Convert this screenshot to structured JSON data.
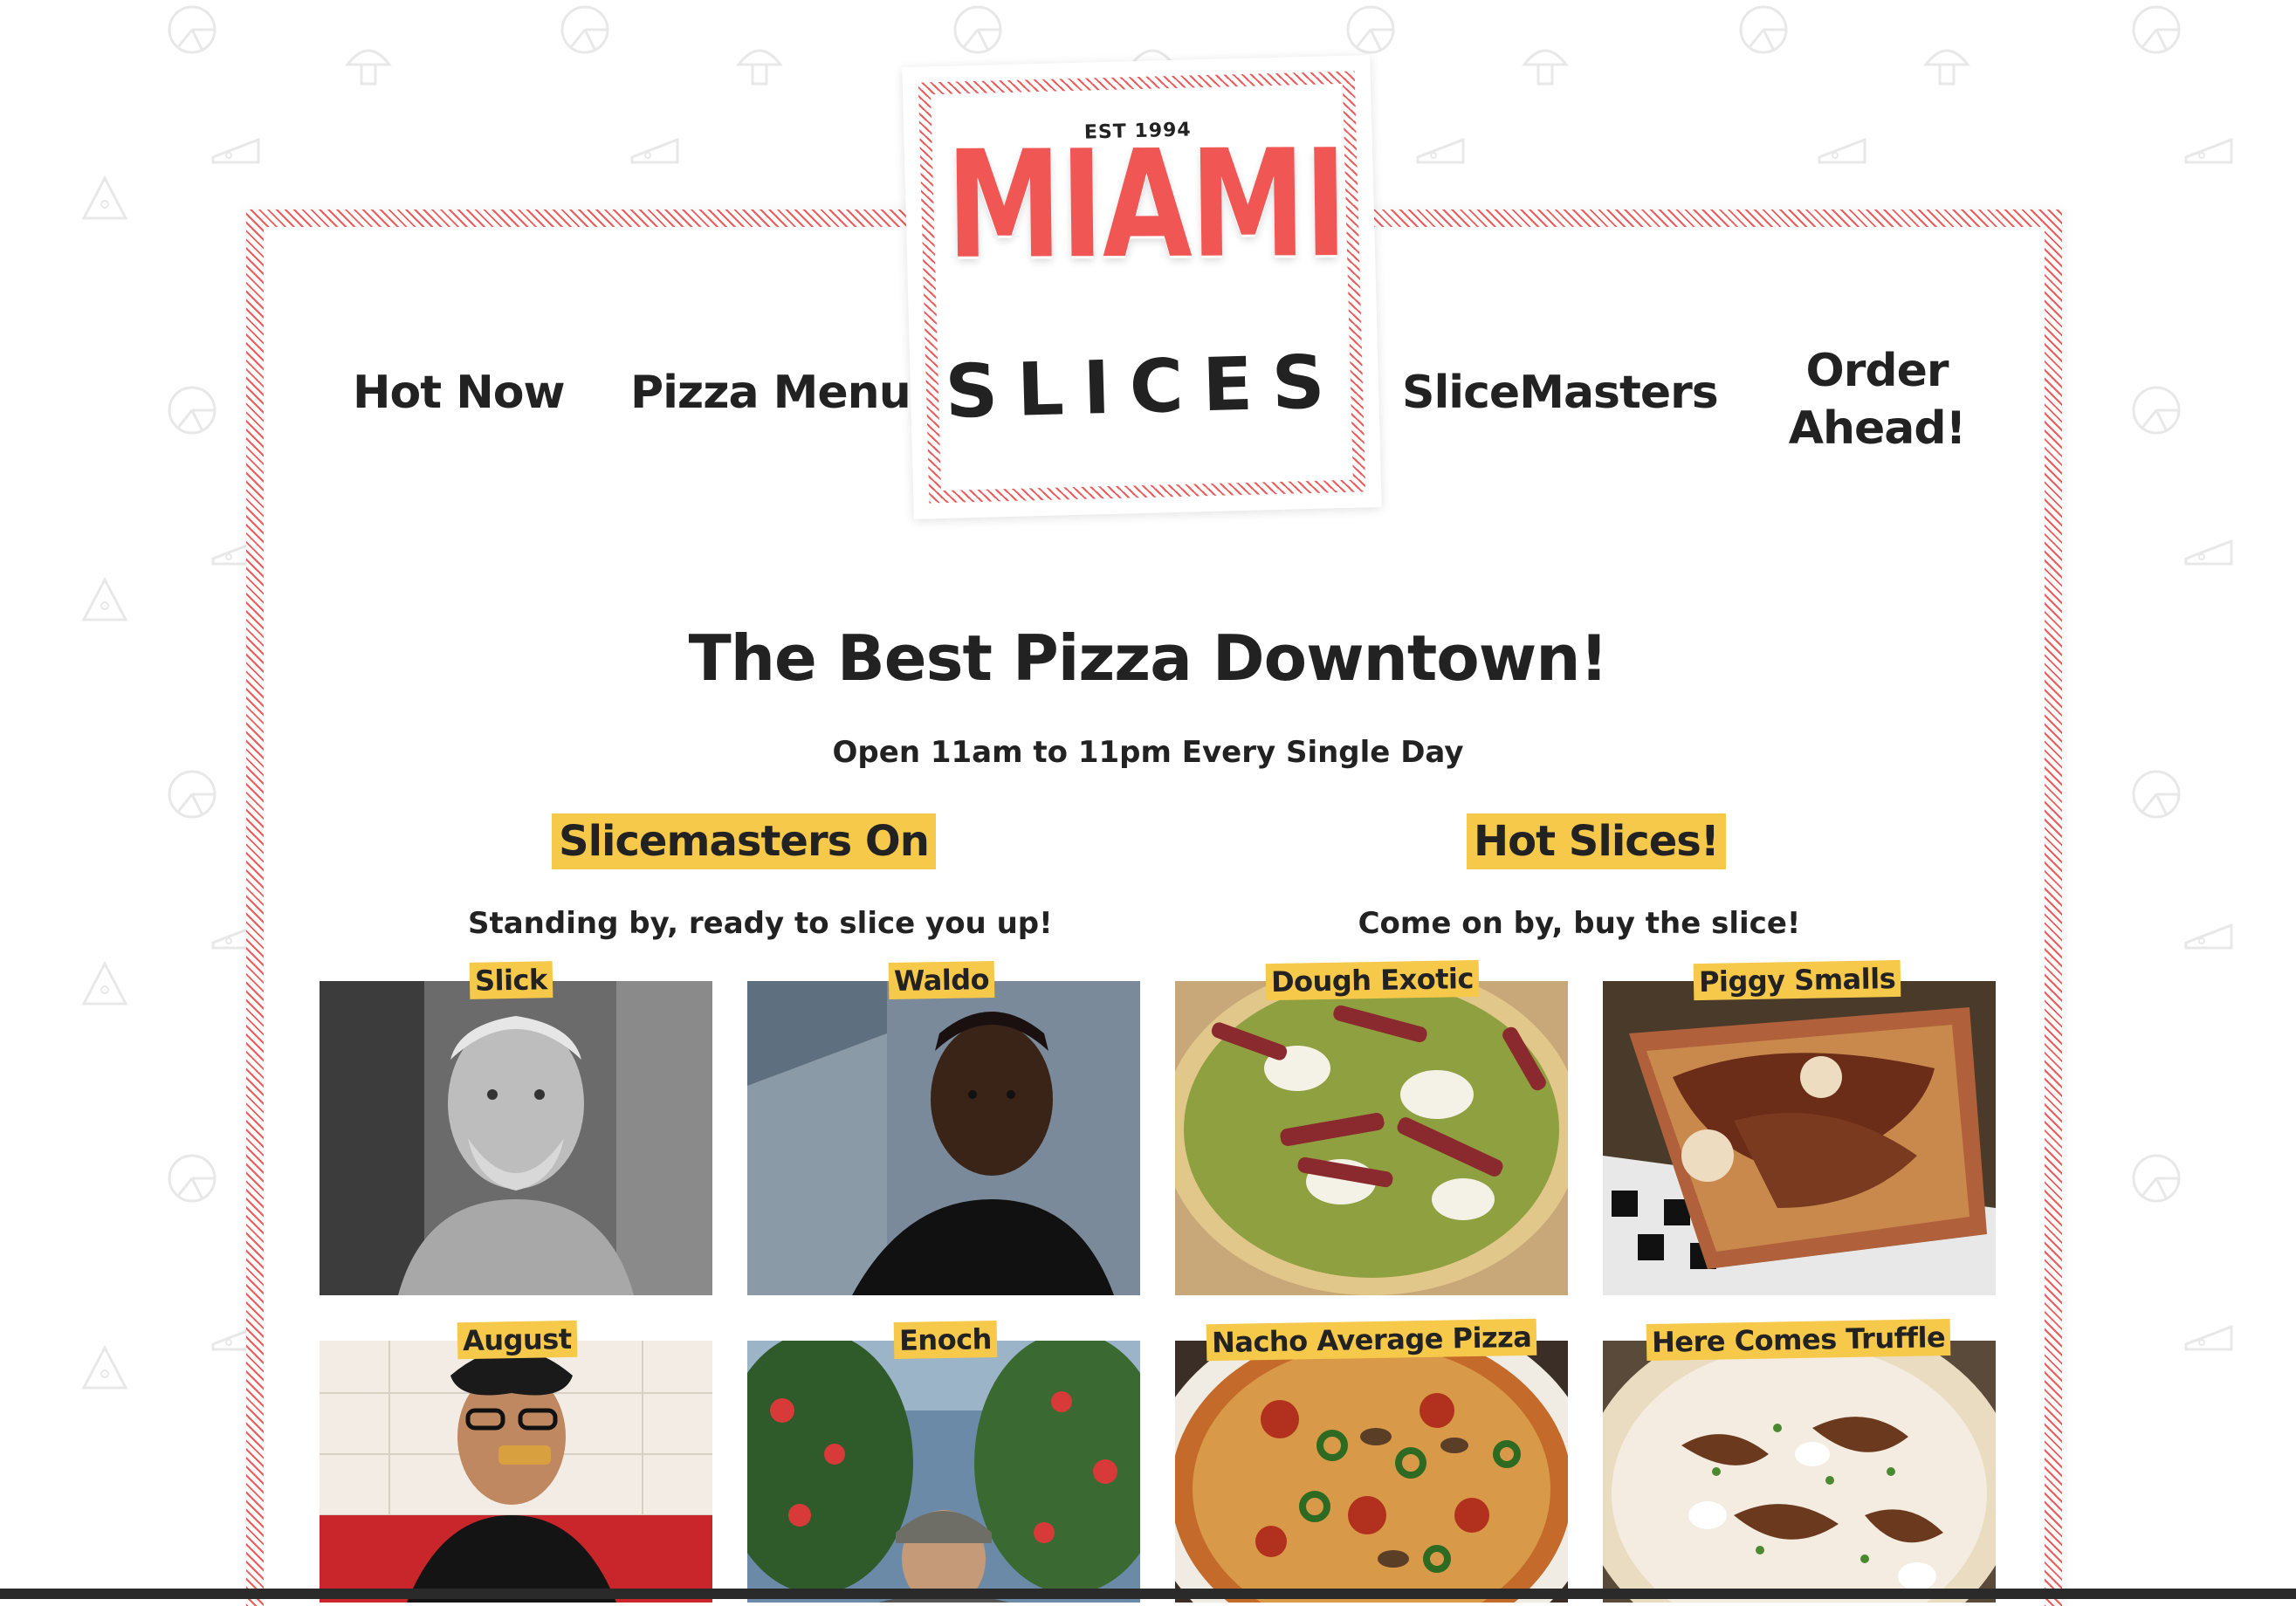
{
  "logo": {
    "est": "EST 1994",
    "name_top": "MIAMI",
    "name_bottom": "SLICES"
  },
  "nav": {
    "hot_now": "Hot Now",
    "pizza_menu": "Pizza Menu",
    "slicemasters": "SliceMasters",
    "order_ahead_line1": "Order",
    "order_ahead_line2": "Ahead!"
  },
  "hero": {
    "title": "The Best Pizza Downtown!",
    "hours": "Open 11am to 11pm Every Single Day"
  },
  "slicemasters_section": {
    "title": "Slicemasters On",
    "subtitle": "Standing by, ready to slice you up!",
    "people": [
      {
        "name": "Slick",
        "image": "elderly-man-portrait"
      },
      {
        "name": "Waldo",
        "image": "young-man-portrait"
      },
      {
        "name": "August",
        "image": "woman-eating-pizza"
      },
      {
        "name": "Enoch",
        "image": "man-in-garden"
      }
    ]
  },
  "hot_slices_section": {
    "title": "Hot Slices!",
    "subtitle": "Come on by, buy the slice!",
    "pizzas": [
      {
        "name": "Dough Exotic",
        "image": "steak-pesto-pizza"
      },
      {
        "name": "Piggy Smalls",
        "image": "bacon-square-pizza"
      },
      {
        "name": "Nacho Average Pizza",
        "image": "jalapeno-pizza"
      },
      {
        "name": "Here Comes Truffle",
        "image": "truffle-pizza"
      }
    ]
  },
  "colors": {
    "accent_red": "#ef5654",
    "stripe_red": "#ee5b5b",
    "label_yellow": "#f7c94a",
    "text_dark": "#222222"
  }
}
